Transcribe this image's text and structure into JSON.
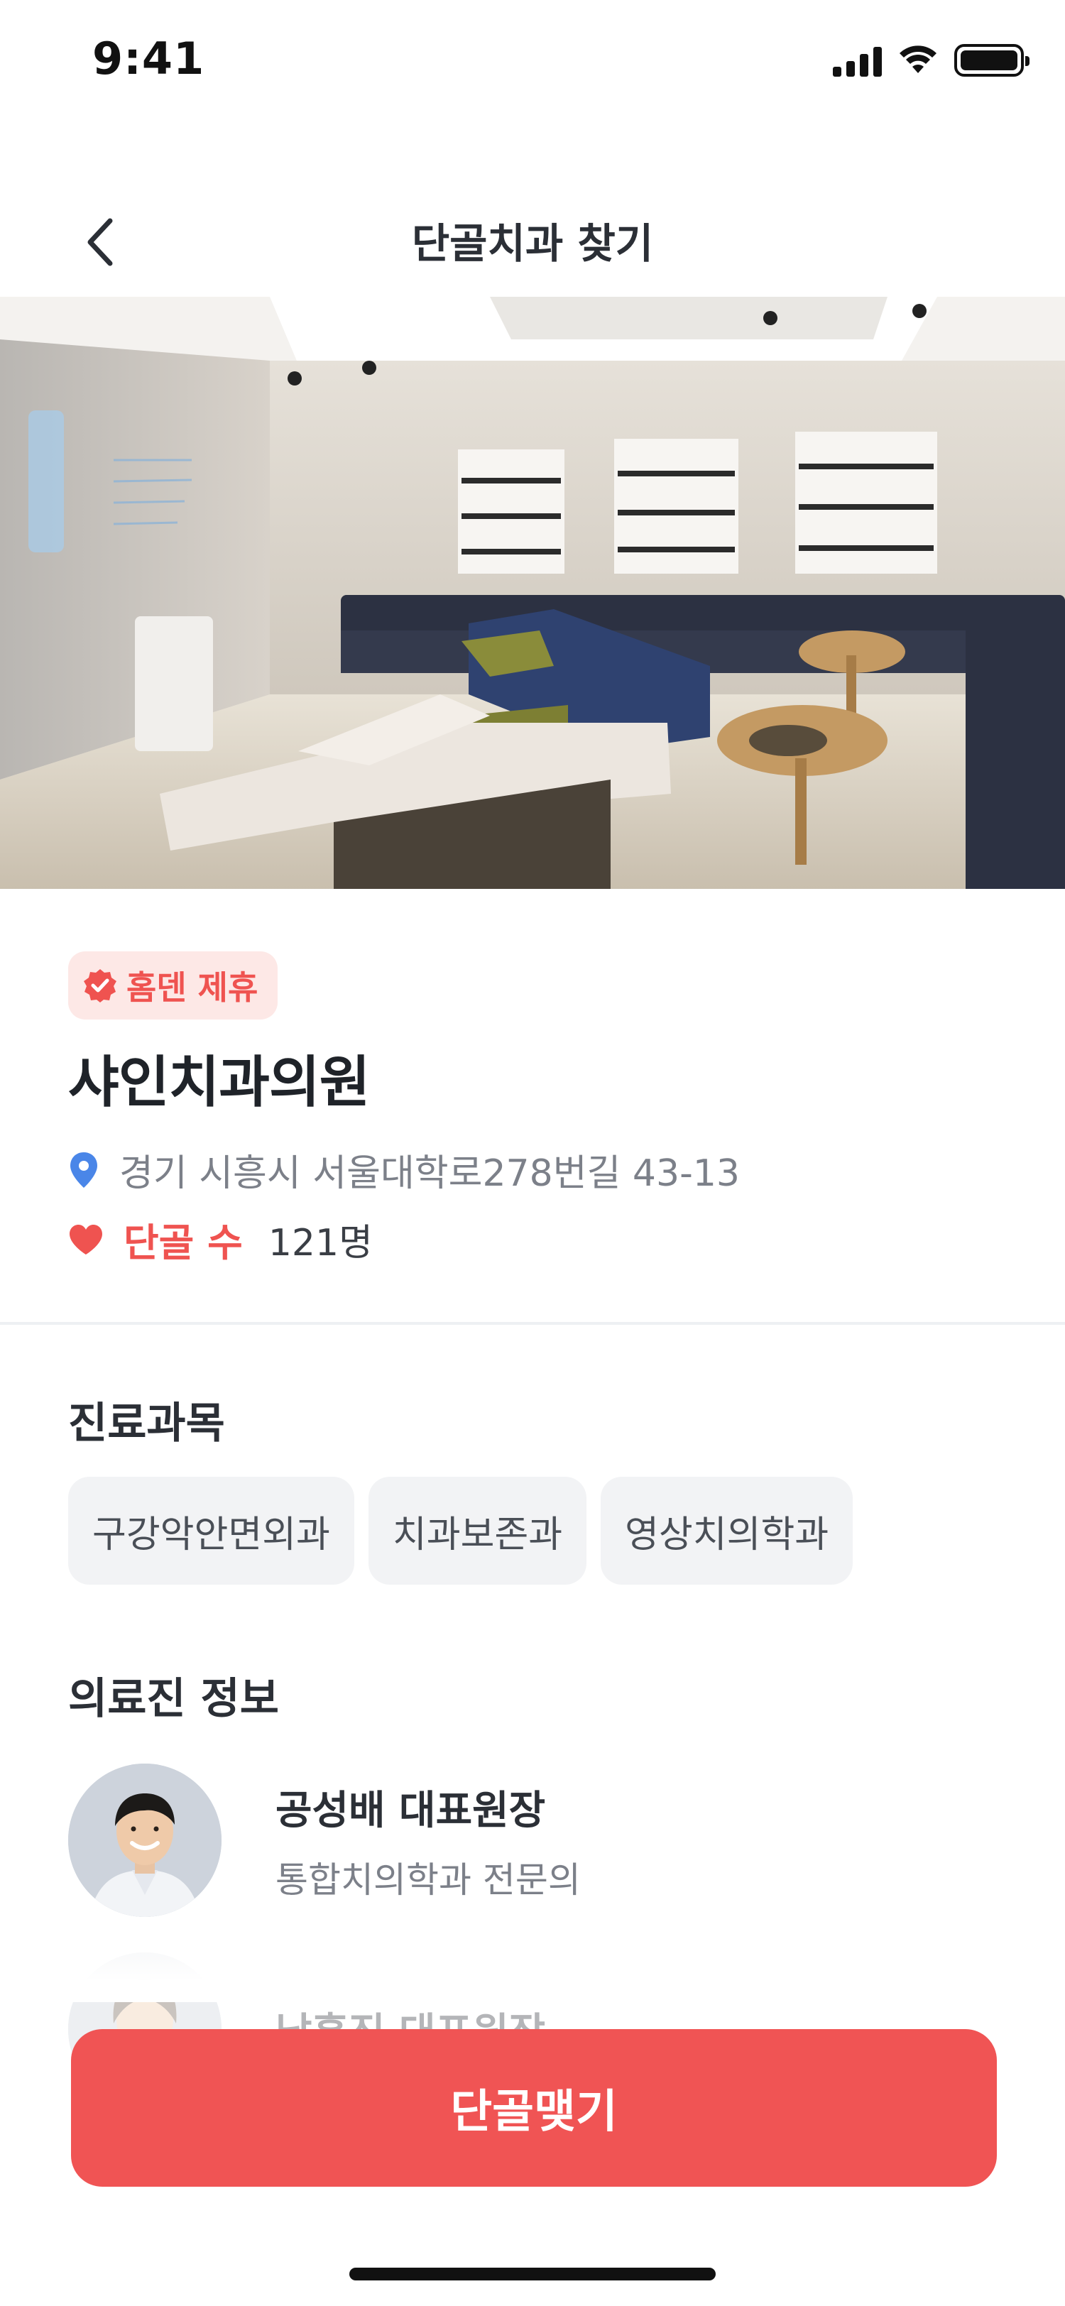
{
  "status_bar": {
    "time": "9:41",
    "icons": [
      "signal-icon",
      "wifi-icon",
      "battery-icon"
    ]
  },
  "nav": {
    "title": "단골치과 찾기",
    "back_icon": "chevron-left-icon"
  },
  "clinic": {
    "badge": "홈덴 제휴",
    "badge_icon": "verified-badge-icon",
    "name": "샤인치과의원",
    "address_icon": "location-pin-icon",
    "address": "경기 시흥시 서울대학로278번길 43-13",
    "favorite_icon": "heart-icon",
    "favorite_label": "단골 수",
    "favorite_count": "121명"
  },
  "subjects": {
    "title": "진료과목",
    "items": [
      "구강악안면외과",
      "치과보존과",
      "영상치의학과"
    ]
  },
  "doctors": {
    "title": "의료진 정보",
    "items": [
      {
        "name": "공성배 대표원장",
        "role": "통합치의학과 전문의"
      },
      {
        "name": "남홍진 대표원장",
        "role": ""
      }
    ]
  },
  "cta": {
    "label": "단골맺기"
  },
  "colors": {
    "accent": "#F05454",
    "badge_bg": "#FDE8E6",
    "location_pin": "#4A86E8",
    "chip_bg": "#F2F3F5",
    "text_primary": "#2B2F36",
    "text_secondary": "#7C8089"
  }
}
